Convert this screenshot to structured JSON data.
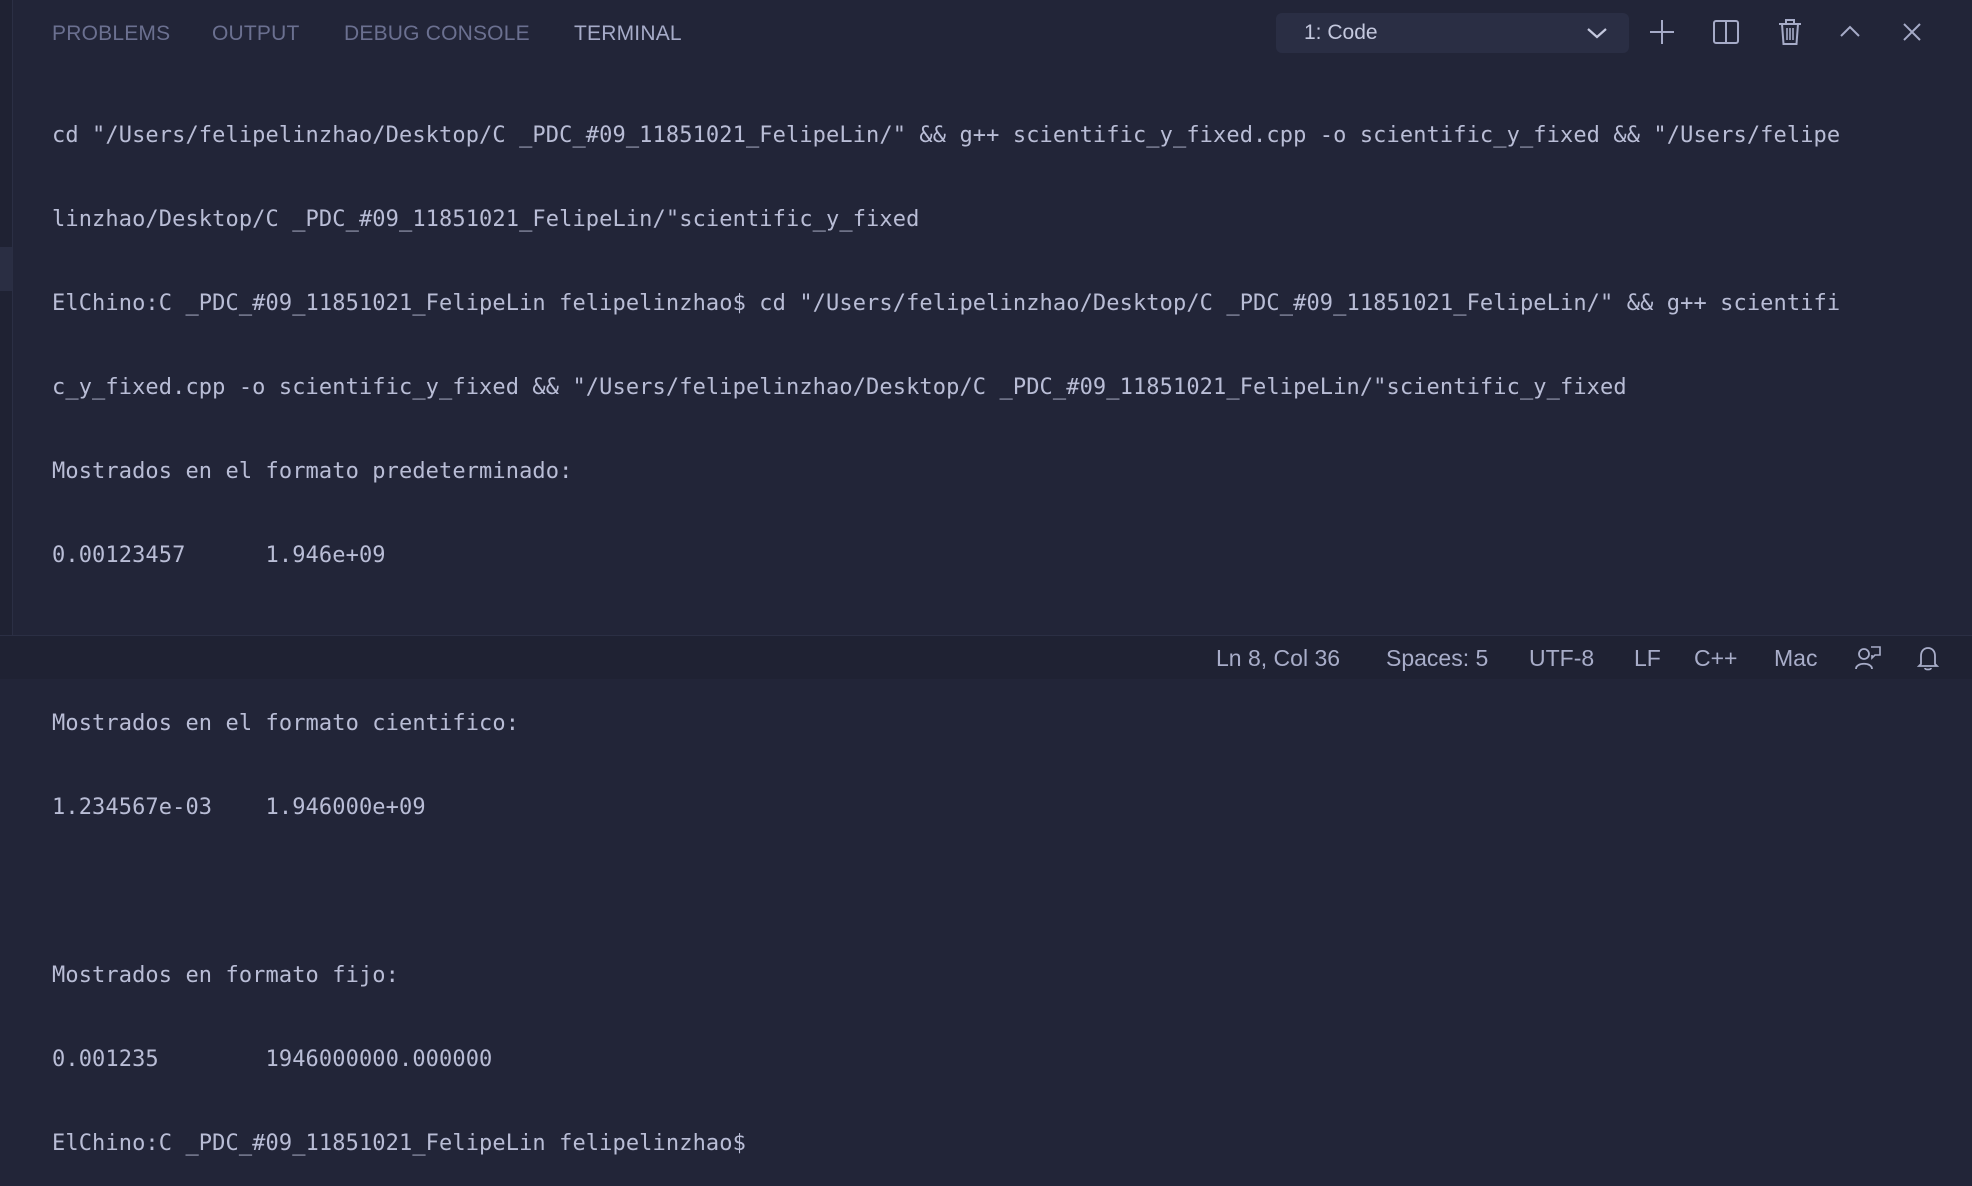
{
  "panel": {
    "tabs": [
      {
        "label": "PROBLEMS",
        "active": false
      },
      {
        "label": "OUTPUT",
        "active": false
      },
      {
        "label": "DEBUG CONSOLE",
        "active": false
      },
      {
        "label": "TERMINAL",
        "active": true
      }
    ],
    "terminal_selector": "1: Code",
    "actions": [
      "plus-icon",
      "split-icon",
      "trash-icon",
      "chevron-up-icon",
      "close-icon"
    ]
  },
  "terminal": {
    "lines": [
      "cd \"/Users/felipelinzhao/Desktop/C _PDC_#09_11851021_FelipeLin/\" && g++ scientific_y_fixed.cpp -o scientific_y_fixed && \"/Users/felipe",
      "linzhao/Desktop/C _PDC_#09_11851021_FelipeLin/\"scientific_y_fixed",
      "ElChino:C _PDC_#09_11851021_FelipeLin felipelinzhao$ cd \"/Users/felipelinzhao/Desktop/C _PDC_#09_11851021_FelipeLin/\" && g++ scientifi",
      "c_y_fixed.cpp -o scientific_y_fixed && \"/Users/felipelinzhao/Desktop/C _PDC_#09_11851021_FelipeLin/\"scientific_y_fixed",
      "Mostrados en el formato predeterminado:",
      "0.00123457      1.946e+09",
      "",
      "Mostrados en el formato cientifico:",
      "1.234567e-03    1.946000e+09",
      "",
      "Mostrados en formato fijo:",
      "0.001235        1946000000.000000",
      "ElChino:C _PDC_#09_11851021_FelipeLin felipelinzhao$"
    ]
  },
  "statusbar": {
    "position": "Ln 8, Col 36",
    "indent": "Spaces: 5",
    "encoding": "UTF-8",
    "eol": "LF",
    "language": "C++",
    "platform": "Mac",
    "icons": [
      "feedback-icon",
      "bell-icon"
    ]
  },
  "colors": {
    "background": "#222538",
    "text": "#b9bdd6",
    "tab_inactive": "#6b7090",
    "tab_active": "#a6abc8"
  }
}
